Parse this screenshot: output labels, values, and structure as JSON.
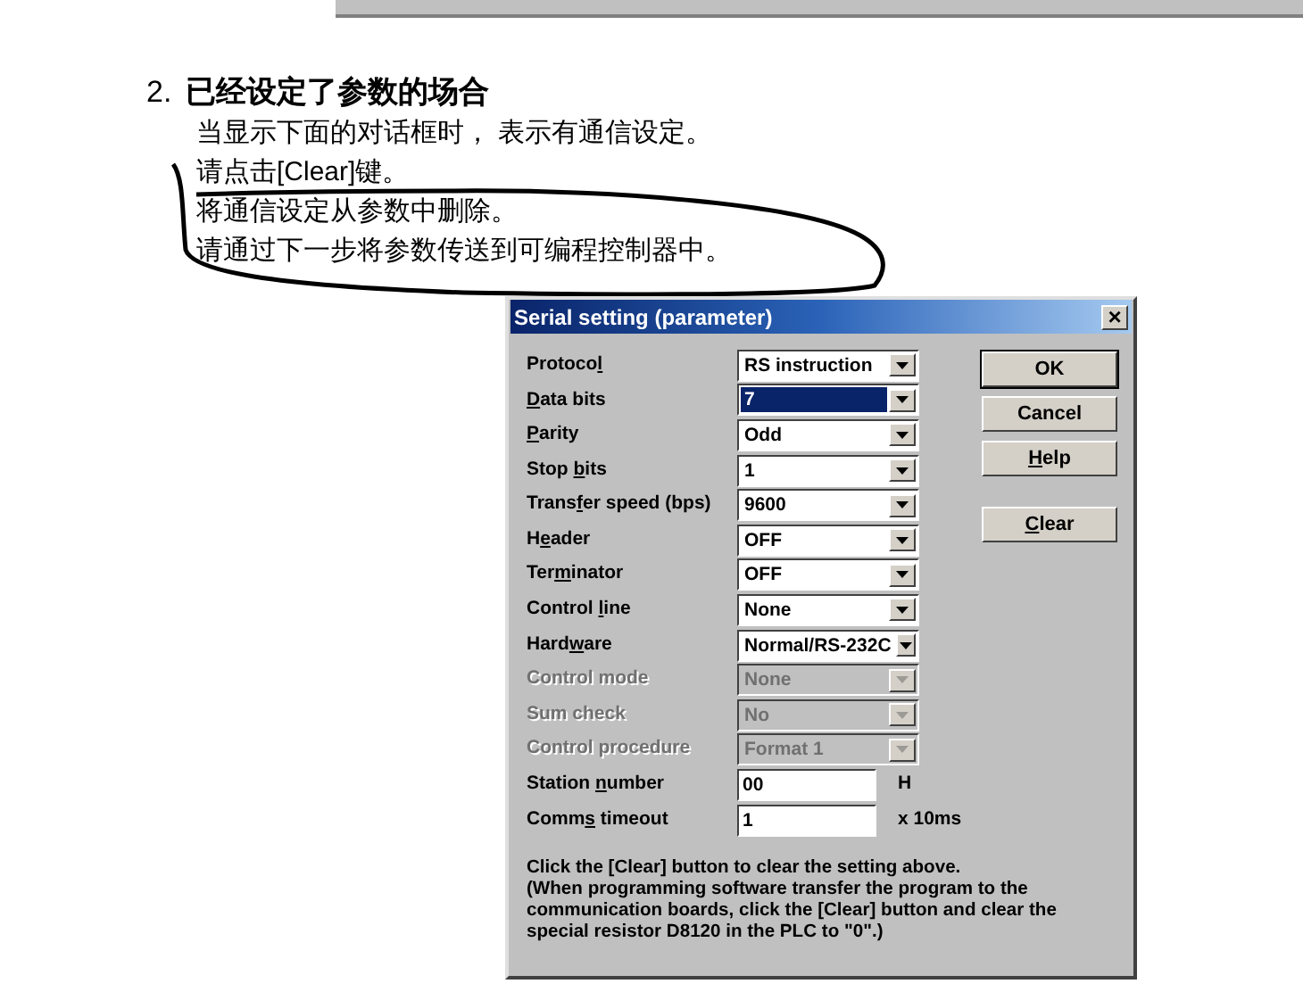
{
  "heading": {
    "number": "2.",
    "title": "已经设定了参数的场合"
  },
  "lines": [
    "当显示下面的对话框时， 表示有通信设定。",
    "请点击[Clear]键。",
    "将通信设定从参数中删除。",
    "请通过下一步将参数传送到可编程控制器中。"
  ],
  "dialog": {
    "title": "Serial setting (parameter)",
    "close": "×",
    "fields": [
      {
        "kind": "select",
        "label": [
          {
            "text": "Protoco",
            "hotkey": false
          },
          {
            "text": "l",
            "hotkey": true
          }
        ],
        "value": "RS instruction",
        "disabled": false,
        "focused": false
      },
      {
        "kind": "select",
        "label": [
          {
            "text": "D",
            "hotkey": true
          },
          {
            "text": "ata bits",
            "hotkey": false
          }
        ],
        "value": "7",
        "disabled": false,
        "focused": true
      },
      {
        "kind": "select",
        "label": [
          {
            "text": "P",
            "hotkey": true
          },
          {
            "text": "arity",
            "hotkey": false
          }
        ],
        "value": "Odd",
        "disabled": false,
        "focused": false
      },
      {
        "kind": "select",
        "label": [
          {
            "text": "Stop ",
            "hotkey": false
          },
          {
            "text": "b",
            "hotkey": true
          },
          {
            "text": "its",
            "hotkey": false
          }
        ],
        "value": "1",
        "disabled": false,
        "focused": false
      },
      {
        "kind": "select",
        "label": [
          {
            "text": "Trans",
            "hotkey": false
          },
          {
            "text": "f",
            "hotkey": true
          },
          {
            "text": "er speed (bps)",
            "hotkey": false
          }
        ],
        "value": "9600",
        "disabled": false,
        "focused": false
      },
      {
        "kind": "select",
        "label": [
          {
            "text": "H",
            "hotkey": false
          },
          {
            "text": "e",
            "hotkey": true
          },
          {
            "text": "ader",
            "hotkey": false
          }
        ],
        "value": "OFF",
        "disabled": false,
        "focused": false
      },
      {
        "kind": "select",
        "label": [
          {
            "text": "Ter",
            "hotkey": false
          },
          {
            "text": "m",
            "hotkey": true
          },
          {
            "text": "inator",
            "hotkey": false
          }
        ],
        "value": "OFF",
        "disabled": false,
        "focused": false
      },
      {
        "kind": "select",
        "label": [
          {
            "text": "Control ",
            "hotkey": false
          },
          {
            "text": "l",
            "hotkey": true
          },
          {
            "text": "ine",
            "hotkey": false
          }
        ],
        "value": "None",
        "disabled": false,
        "focused": false
      },
      {
        "kind": "select",
        "label": [
          {
            "text": "Hard",
            "hotkey": false
          },
          {
            "text": "w",
            "hotkey": true
          },
          {
            "text": "are",
            "hotkey": false
          }
        ],
        "value": "Normal/RS-232C",
        "disabled": false,
        "focused": false
      },
      {
        "kind": "select",
        "label": [
          {
            "text": "Control mode",
            "hotkey": false
          }
        ],
        "value": "None",
        "disabled": true,
        "focused": false
      },
      {
        "kind": "select",
        "label": [
          {
            "text": "Sum check",
            "hotkey": false
          }
        ],
        "value": "No",
        "disabled": true,
        "focused": false
      },
      {
        "kind": "select",
        "label": [
          {
            "text": "Control procedure",
            "hotkey": false
          }
        ],
        "value": "Format 1",
        "disabled": true,
        "focused": false
      },
      {
        "kind": "input",
        "label": [
          {
            "text": "Station ",
            "hotkey": false
          },
          {
            "text": "n",
            "hotkey": true
          },
          {
            "text": "umber",
            "hotkey": false
          }
        ],
        "value": "00",
        "unit": "H"
      },
      {
        "kind": "input",
        "label": [
          {
            "text": "Comm",
            "hotkey": false
          },
          {
            "text": "s",
            "hotkey": true
          },
          {
            "text": " timeout",
            "hotkey": false
          }
        ],
        "value": "1",
        "unit": "x 10ms"
      }
    ],
    "buttons": [
      {
        "label": [
          {
            "text": "OK",
            "hotkey": false
          }
        ],
        "default": true
      },
      {
        "label": [
          {
            "text": "Cancel",
            "hotkey": false
          }
        ],
        "default": false
      },
      {
        "label": [
          {
            "text": "H",
            "hotkey": true
          },
          {
            "text": "elp",
            "hotkey": false
          }
        ],
        "default": false
      },
      {
        "label": [
          {
            "text": "C",
            "hotkey": true
          },
          {
            "text": "lear",
            "hotkey": false
          }
        ],
        "default": false
      }
    ],
    "note": "Click the [Clear] button to clear the setting above.\n(When programming software transfer the program to the communication boards, click the [Clear] button and clear the special resistor D8120 in the PLC to \"0\".)"
  }
}
